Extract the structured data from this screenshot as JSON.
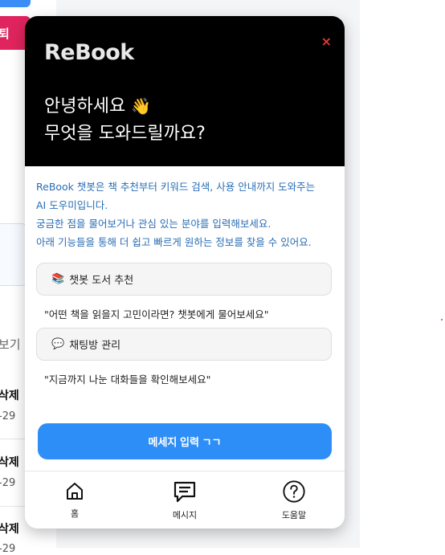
{
  "background": {
    "button_label": "퇴",
    "see_label": "보기",
    "rows": [
      {
        "action": "삭제",
        "date": "-29"
      },
      {
        "action": "삭제",
        "date": "-29"
      },
      {
        "action": "삭제",
        "date": "-29"
      }
    ]
  },
  "chatbot": {
    "brand": "ReBook",
    "close_label": "×",
    "greeting_line1": "안녕하세요",
    "greeting_emoji": "👋",
    "greeting_line2": "무엇을 도와드릴까요?",
    "intro": [
      "ReBook 챗봇은 책 추천부터 키워드 검색, 사용 안내까지 도와주는",
      "AI 도우미입니다.",
      "궁금한 점을 물어보거나 관심 있는 분야를 입력해보세요.",
      "아래 기능들을 통해 더 쉽고 빠르게 원하는 정보를 찾을 수 있어요."
    ],
    "features": [
      {
        "icon": "📚",
        "label": "챗봇 도서 추천",
        "description": "\"어떤 책을 읽을지 고민이라면? 챗봇에게 물어보세요\""
      },
      {
        "icon": "💬",
        "label": "채팅방 관리",
        "description": "\"지금까지 나눈 대화들을 확인해보세요\""
      }
    ],
    "send_button": "메세지 입력 ㄱㄱ",
    "nav": [
      {
        "icon": "home-icon",
        "label": "홈"
      },
      {
        "icon": "message-icon",
        "label": "메시지"
      },
      {
        "icon": "help-icon",
        "label": "도움말"
      }
    ]
  }
}
